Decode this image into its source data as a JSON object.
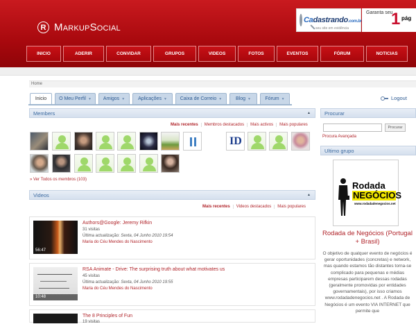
{
  "header": {
    "logo_symbol": "R",
    "logo_text": "MarkupSocial",
    "ad1_brand_a": "Ca",
    "ad1_brand_b": "dastrando",
    "ad1_brand_c": ".com.br",
    "ad1_sub": "seu site em evidência",
    "ad2_text": "Garanta seu",
    "ad2_big": "1",
    "ad2_pag": "pág"
  },
  "nav": [
    "INICIO",
    "ADERIR",
    "CONVIDAR",
    "GRUPOS",
    "VIDEOS",
    "FOTOS",
    "EVENTOS",
    "FÓRUM",
    "NOTICIAS"
  ],
  "breadcrumb": "Home",
  "tabs": [
    "Inicio",
    "O Meu Perfil",
    "Amigos",
    "Aplicações",
    "Caixa de Correio",
    "Blog",
    "Fórum"
  ],
  "logout": "Logout",
  "members": {
    "title": "Members",
    "links": [
      "Mais recentes",
      "Membros destacados",
      "Mais activos",
      "Mais populares"
    ],
    "more": "Ver Todos os membros (103)"
  },
  "videos": {
    "title": "Videos",
    "links": [
      "Mais recentes",
      "Videos destacados",
      "Mais populares"
    ],
    "items": [
      {
        "title": "Authors@Google: Jeremy Rifkin",
        "views": "31 visitas",
        "updated_label": "Última actualização:",
        "updated": "Sexta, 04 Junho 2010 19:54",
        "author": "Maria do Céu Mendes do Nascimento",
        "duration": "56:47"
      },
      {
        "title": "RSA Animate - Drive: The surprising truth about what motivates us",
        "views": "45 visitas",
        "updated_label": "Última actualização:",
        "updated": "Sexta, 04 Junho 2010 19:55",
        "author": "Maria do Céu Mendes do Nascimento",
        "duration": "10:48"
      },
      {
        "title": "The 8 Principles of Fun",
        "views": "19 visitas",
        "updated_label": "",
        "updated": "",
        "author": "",
        "duration": ""
      }
    ]
  },
  "search": {
    "title": "Procurar",
    "button": "Procurar",
    "advanced": "Procura Avançada"
  },
  "latest_group": {
    "title": "Ultimo grupo",
    "img_line1": "Rodada de",
    "img_line2": "NEGÓCIOS",
    "img_url": "www.rodadadenegocios.net",
    "name": "Rodada de Negócios (Portugal + Brasil)",
    "description": "O objetivo de qualquer evento de negócios é gerar oportunidades (concretas) e network, mas quando estamos tão distantes torna-se complicado para pequenas e médias empresas participarem dessas rodadas (geralmente promovidas por entidades governamentais), por isso criamos www.rodadadenegocios.net . A Rodada de Negócios é um evento VIA INTERNET que permite que"
  }
}
